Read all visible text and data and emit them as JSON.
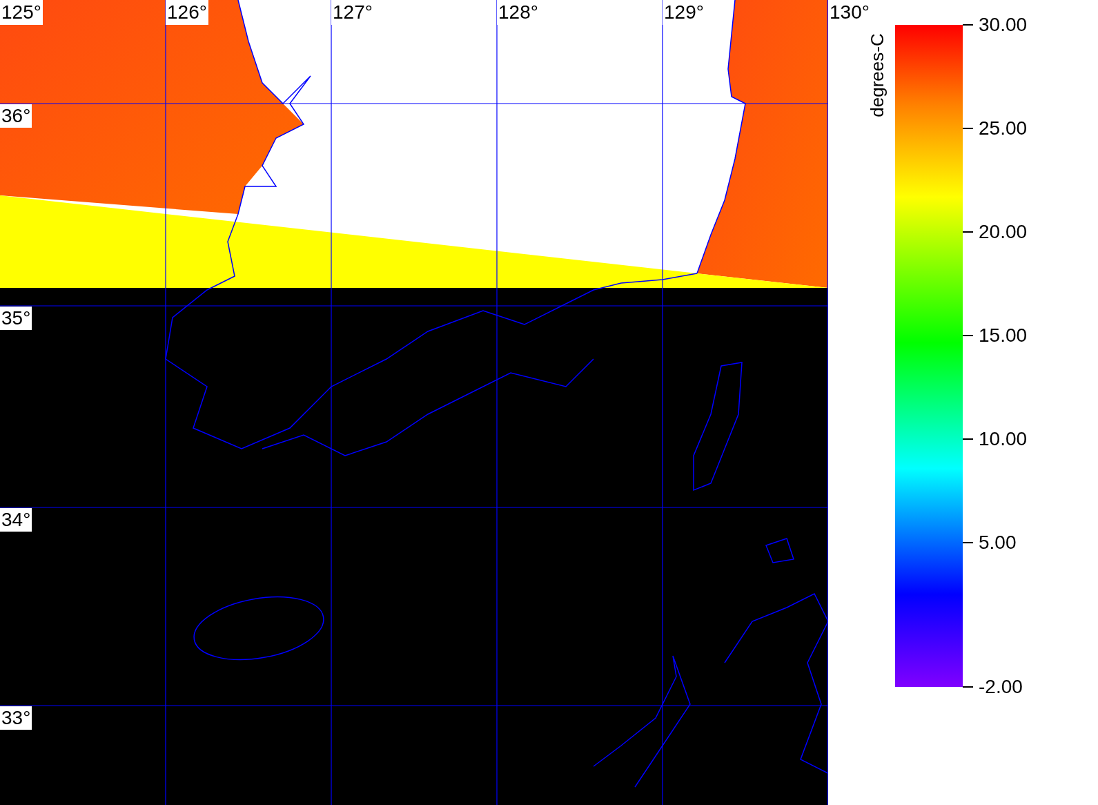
{
  "map": {
    "longitude_labels": [
      "125°",
      "126°",
      "127°",
      "128°",
      "129°",
      "130°"
    ],
    "latitude_labels": [
      "36°",
      "35°",
      "34°",
      "33°"
    ]
  },
  "colorbar": {
    "title": "degrees-C",
    "ticks": [
      "30.00",
      "25.00",
      "20.00",
      "15.00",
      "10.00",
      "5.00",
      "-2.00"
    ]
  }
}
